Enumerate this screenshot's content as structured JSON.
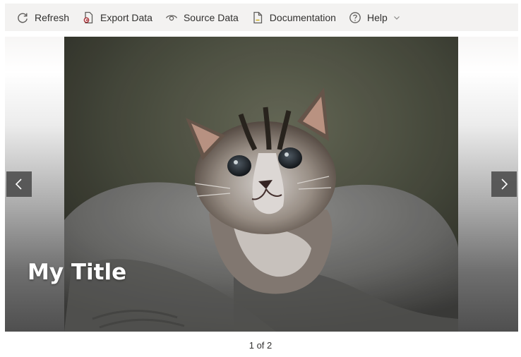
{
  "toolbar": {
    "items": [
      {
        "label": "Refresh",
        "icon": "refresh-icon"
      },
      {
        "label": "Export Data",
        "icon": "export-data-icon"
      },
      {
        "label": "Source Data",
        "icon": "eye-icon"
      },
      {
        "label": "Documentation",
        "icon": "document-icon"
      },
      {
        "label": "Help",
        "icon": "help-icon",
        "has_dropdown": true
      }
    ]
  },
  "carousel": {
    "slide_title": "My Title",
    "image_subject": "kitten-in-blanket",
    "prev_icon": "chevron-left-icon",
    "next_icon": "chevron-right-icon",
    "pager_text": "1 of 2"
  },
  "colors": {
    "toolbar_bg": "#f3f2f1",
    "text": "#323130",
    "nav_button_bg": "#464646",
    "title_text": "#ffffff"
  }
}
